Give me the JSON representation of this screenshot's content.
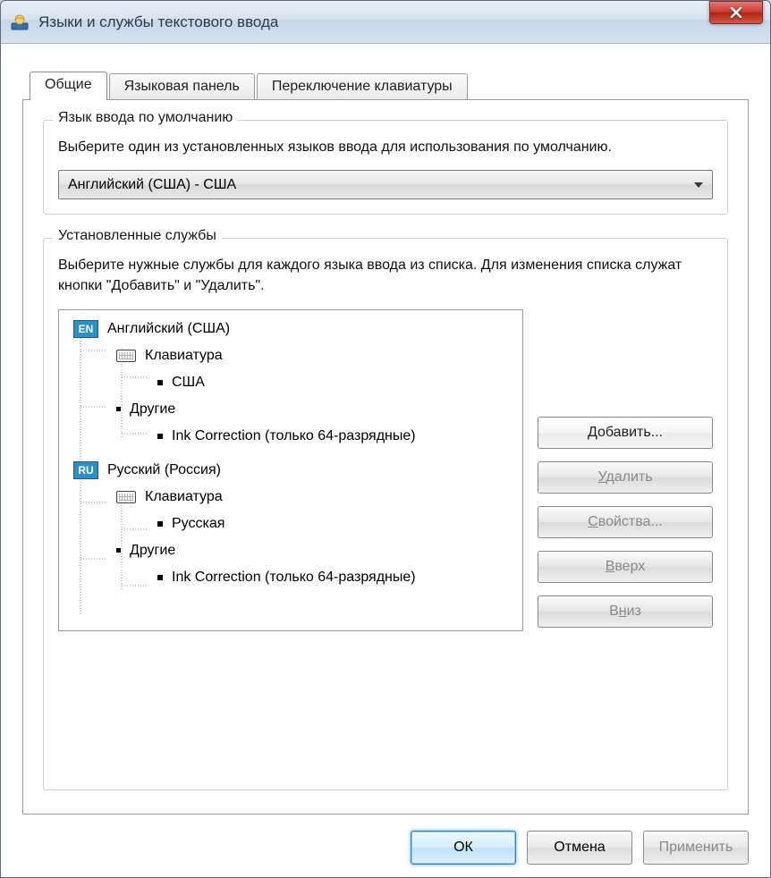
{
  "window": {
    "title": "Языки и службы текстового ввода"
  },
  "tabs": {
    "general": "Общие",
    "langbar": "Языковая панель",
    "switching": "Переключение клавиатуры"
  },
  "group_default": {
    "legend": "Язык ввода по умолчанию",
    "desc": "Выберите один из установленных языков ввода для использования по умолчанию.",
    "selected": "Английский (США) - США"
  },
  "group_services": {
    "legend": "Установленные службы",
    "desc": "Выберите нужные службы для каждого языка ввода из списка. Для изменения списка служат кнопки \"Добавить\" и \"Удалить\".",
    "languages": [
      {
        "badge": "EN",
        "name": "Английский (США)",
        "categories": [
          {
            "label": "Клавиатура",
            "items": [
              "США"
            ]
          },
          {
            "label": "Другие",
            "items": [
              "Ink Correction (только 64-разрядные)"
            ]
          }
        ]
      },
      {
        "badge": "RU",
        "name": "Русский (Россия)",
        "categories": [
          {
            "label": "Клавиатура",
            "items": [
              "Русская"
            ]
          },
          {
            "label": "Другие",
            "items": [
              "Ink Correction (только 64-разрядные)"
            ]
          }
        ]
      }
    ]
  },
  "buttons": {
    "add": "Добавить...",
    "remove": "Удалить",
    "properties": "Свойства...",
    "up": "Вверх",
    "down": "Вниз",
    "ok": "ОК",
    "cancel": "Отмена",
    "apply": "Применить"
  }
}
